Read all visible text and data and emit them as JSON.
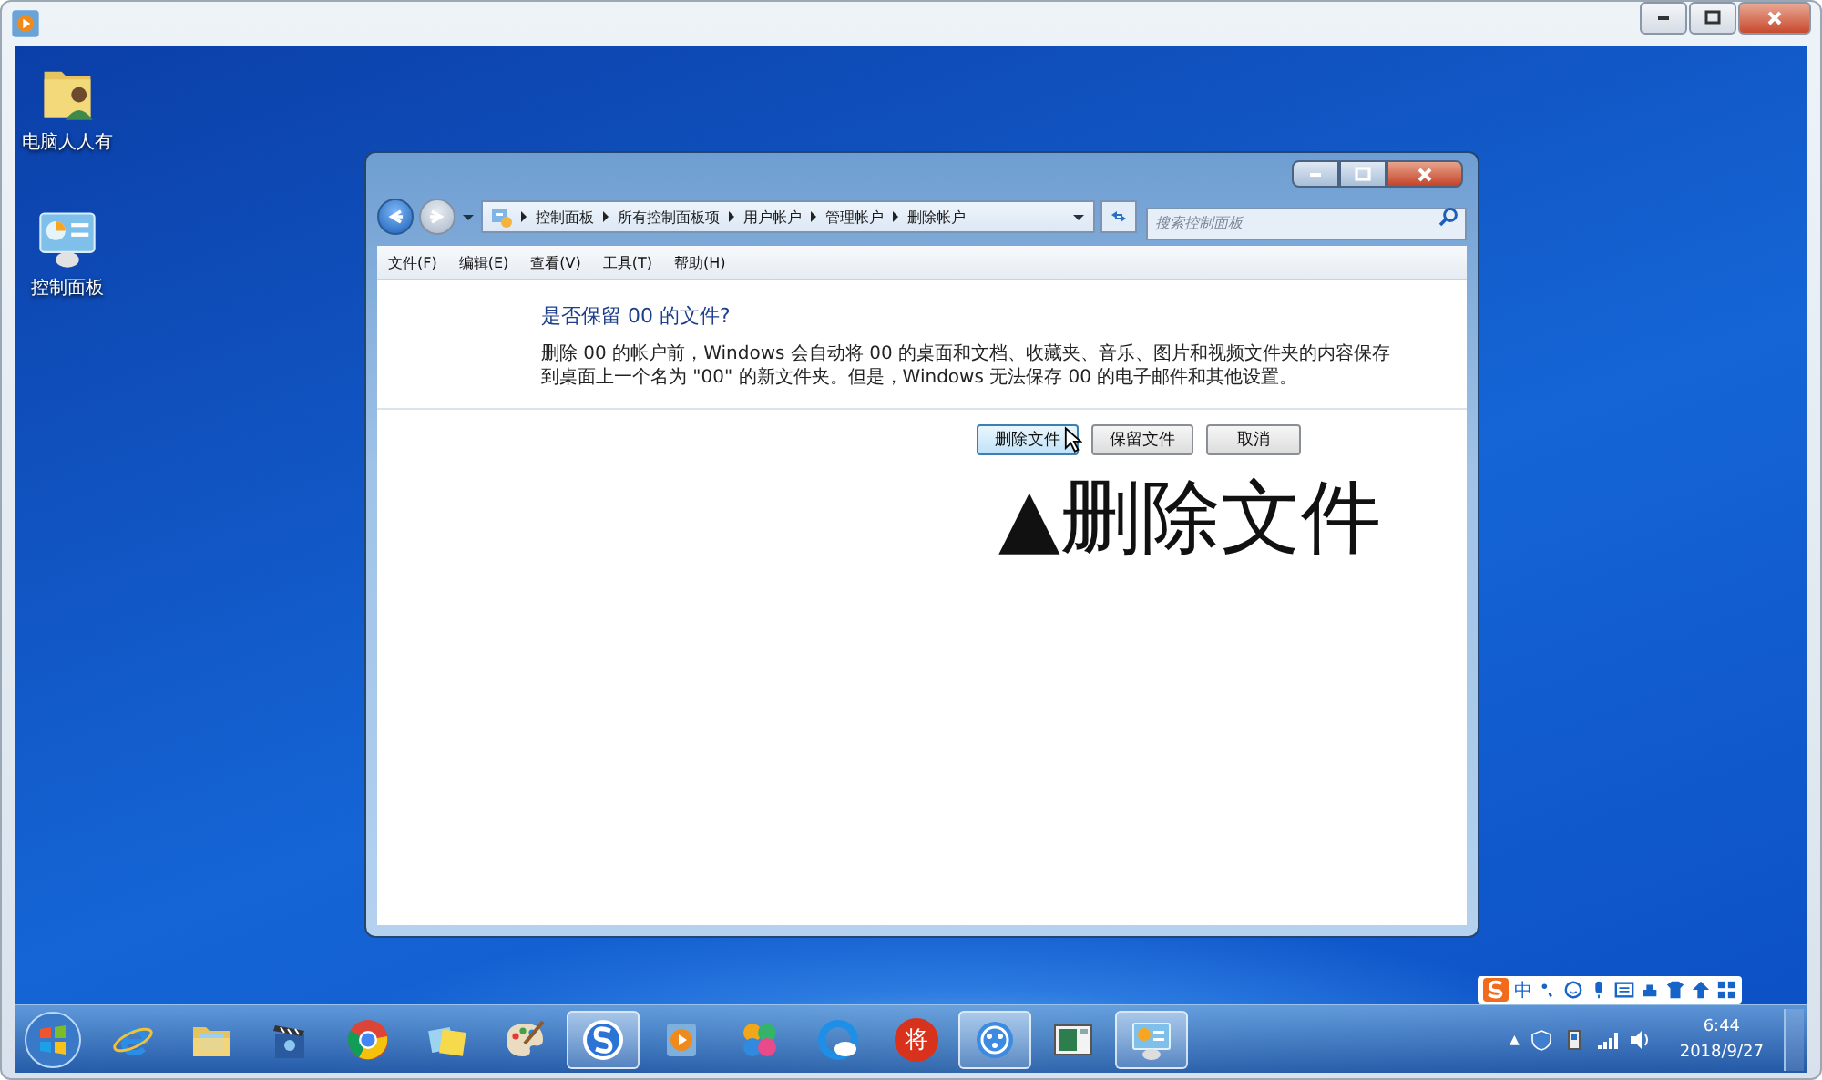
{
  "desktop_icons": [
    {
      "label": "电脑人人有"
    },
    {
      "label": "控制面板"
    }
  ],
  "window": {
    "address_path": [
      "控制面板",
      "所有控制面板项",
      "用户帐户",
      "管理帐户",
      "删除帐户"
    ],
    "search": {
      "placeholder": "搜索控制面板"
    },
    "menu": [
      "文件(F)",
      "编辑(E)",
      "查看(V)",
      "工具(T)",
      "帮助(H)"
    ],
    "heading": "是否保留 00 的文件?",
    "description": "删除 00 的帐户前，Windows 会自动将 00 的桌面和文档、收藏夹、音乐、图片和视频文件夹的内容保存到桌面上一个名为 \"00\" 的新文件夹。但是，Windows 无法保存 00 的电子邮件和其他设置。",
    "buttons": [
      {
        "label": "删除文件",
        "hovered": true
      },
      {
        "label": "保留文件",
        "hovered": false
      },
      {
        "label": "取消",
        "hovered": false
      }
    ]
  },
  "annotation": "▲删除文件",
  "taskbar": {
    "items": [
      {
        "active": false
      },
      {
        "active": false
      },
      {
        "active": false
      },
      {
        "active": false
      },
      {
        "active": false
      },
      {
        "active": false
      },
      {
        "active": true
      },
      {
        "active": false
      },
      {
        "active": false
      },
      {
        "active": false
      },
      {
        "label": "将",
        "active": false
      },
      {
        "active": true
      },
      {
        "active": false
      },
      {
        "active": true
      }
    ],
    "ime_label": "中",
    "tray_caret": "▲",
    "time": "6:44",
    "date": "2018/9/27"
  }
}
